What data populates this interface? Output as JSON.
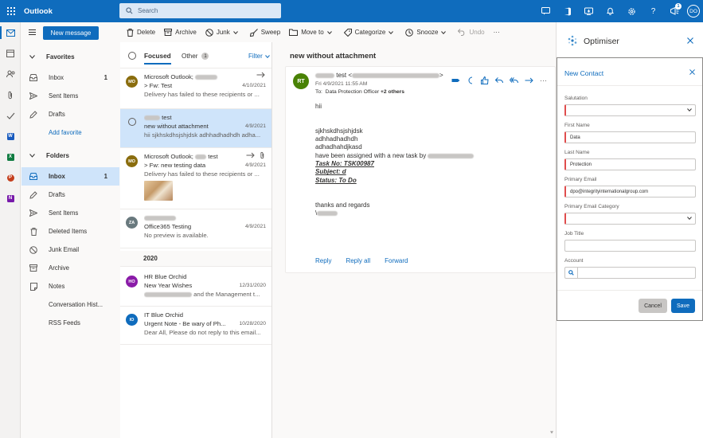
{
  "app": {
    "title": "Outlook",
    "user_initials": "DO"
  },
  "search": {
    "placeholder": "Search"
  },
  "topbar": {
    "notification_badge": "1"
  },
  "new_message_label": "New message",
  "folders": {
    "favorites_label": "Favorites",
    "favorites": [
      {
        "label": "Inbox",
        "count": "1",
        "icon": "inbox-icon"
      },
      {
        "label": "Sent Items",
        "icon": "send-icon"
      },
      {
        "label": "Drafts",
        "icon": "pencil-icon"
      }
    ],
    "add_favorite": "Add favorite",
    "folders_label": "Folders",
    "items": [
      {
        "label": "Inbox",
        "count": "1",
        "icon": "inbox-icon"
      },
      {
        "label": "Drafts",
        "icon": "pencil-icon"
      },
      {
        "label": "Sent Items",
        "icon": "send-icon"
      },
      {
        "label": "Deleted Items",
        "icon": "trash-icon"
      },
      {
        "label": "Junk Email",
        "icon": "block-icon"
      },
      {
        "label": "Archive",
        "icon": "archive-icon"
      },
      {
        "label": "Notes",
        "icon": "note-icon"
      },
      {
        "label": "Conversation Hist...",
        "icon": "none"
      },
      {
        "label": "RSS Feeds",
        "icon": "none"
      }
    ]
  },
  "toolbar": {
    "delete": "Delete",
    "archive": "Archive",
    "junk": "Junk",
    "sweep": "Sweep",
    "move_to": "Move to",
    "categorize": "Categorize",
    "snooze": "Snooze",
    "undo": "Undo",
    "more": "···"
  },
  "list": {
    "tab_focused": "Focused",
    "tab_other": "Other",
    "other_count": "1",
    "filter": "Filter",
    "messages": [
      {
        "initials": "MO",
        "avatar_color": "#8a6d0e",
        "sender": "Microsoft Outlook;",
        "subject": "> Fw: Test",
        "date": "4/10/2021",
        "preview": "Delivery has failed to these recipients or ..."
      },
      {
        "initials": "",
        "sender": "test",
        "subject": "new without attachment",
        "date": "4/9/2021",
        "preview": "hii sjkhskdhsjshjdsk adhhadhadhdh adha..."
      },
      {
        "initials": "MO",
        "avatar_color": "#8a6d0e",
        "sender": "Microsoft Outlook;",
        "sender_suffix": "test",
        "subject": "> Fw: new testing data",
        "date": "4/9/2021",
        "preview": "Delivery has failed to these recipients or ..."
      },
      {
        "initials": "ZA",
        "avatar_color": "#69797e",
        "sender": "",
        "subject": "Office365 Testing",
        "date": "4/9/2021",
        "preview": "No preview is available."
      }
    ],
    "group_2020": "2020",
    "messages_2020": [
      {
        "initials": "HO",
        "avatar_color": "#8a1ba8",
        "sender": "HR Blue Orchid",
        "subject": "New Year Wishes",
        "date": "12/31/2020",
        "preview": "and the Management t..."
      },
      {
        "initials": "IO",
        "avatar_color": "#0f6cbd",
        "sender": "IT Blue Orchid",
        "subject": "Urgent Note - Be wary of Ph...",
        "date": "10/28/2020",
        "preview": "Dear All, Please do not reply to this email..."
      }
    ]
  },
  "reading": {
    "subject": "new without attachment",
    "avatar_initials": "RT",
    "from_name": "test",
    "date": "Fri 4/9/2021 11:55 AM",
    "to_prefix": "To:",
    "to": "Data Protection Officer",
    "to_more": "+2 others",
    "body": {
      "greeting": "hii",
      "line1": "sjkhskdhsjshjdsk",
      "line2": "adhhadhadhdh",
      "line3": "adhadhahdjkasd",
      "assigned": " have been assigned with a new task by",
      "task_no": "Task No:  TSK00987",
      "subject_line": "Subject:  d",
      "status": "Status:  To Do",
      "thanks": "thanks and regards",
      "sig": "\\"
    },
    "reply": "Reply",
    "reply_all": "Reply all",
    "forward": "Forward"
  },
  "panel": {
    "title": "Optimiser",
    "form_title": "New Contact",
    "fields": {
      "salutation_label": "Salutation",
      "first_name_label": "First Name",
      "first_name_value": "Data",
      "last_name_label": "Last Name",
      "last_name_value": "Protection",
      "email_label": "Primary Email",
      "email_value": "dpo@integrityinternationalgroup.com",
      "email_category_label": "Primary Email Category",
      "job_title_label": "Job Title",
      "account_label": "Account"
    },
    "cancel": "Cancel",
    "save": "Save"
  }
}
